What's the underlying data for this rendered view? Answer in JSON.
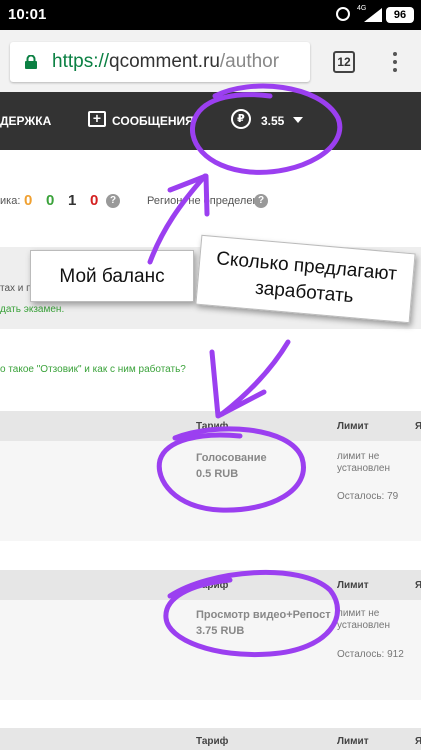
{
  "status_bar": {
    "time": "10:01",
    "network": "4G",
    "battery": "96"
  },
  "browser": {
    "url_scheme": "https://",
    "url_host": "qcomment.ru",
    "url_path": "/author",
    "tab_count": "12"
  },
  "site_nav": {
    "support_label": "ДЕРЖКА",
    "messages_label": "СООБЩЕНИЯ",
    "currency_symbol": "₽",
    "balance": "3.55",
    "avatar_color": "#2fa84f"
  },
  "profile": {
    "rating_label": "ика:",
    "stats": [
      {
        "value": "0",
        "color": "#f0a030"
      },
      {
        "value": "0",
        "color": "#3aa23a"
      },
      {
        "value": "1",
        "color": "#333333"
      },
      {
        "value": "0",
        "color": "#d42020"
      }
    ],
    "region_label": "Регион: не определен",
    "exam_line_1": "тах и п",
    "exam_link": "дать экзамен.",
    "faq_link": "о такое \"Отзовик\" и как с ним работать?"
  },
  "table_headers": {
    "tariff": "Тариф",
    "limit": "Лимит",
    "extra": "Я"
  },
  "tasks": [
    {
      "name": "Голосование",
      "price": "0.5 RUB",
      "limit": "лимит не установлен",
      "remaining": "Осталось: 79"
    },
    {
      "name": "Просмотр видео+Репост",
      "price": "3.75 RUB",
      "limit": "лимит не установлен",
      "remaining": "Осталось: 912"
    }
  ],
  "annotations": {
    "balance_callout": "Мой баланс",
    "earn_callout": "Сколько предлагают заработать",
    "ink_color": "#9b3ff0"
  }
}
